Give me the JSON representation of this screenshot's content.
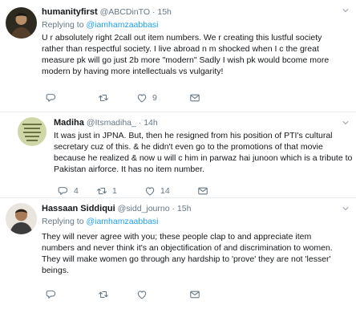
{
  "tweets": [
    {
      "name": "humanityfirst",
      "handle": "@ABCDinTO",
      "dot": "·",
      "time": "15h",
      "replying_label": "Replying to",
      "replying_to": "@iamhamzaabbasi",
      "lines": [
        "U r absolutely right 2call out item numbers. We r creating this lustful society",
        "rather than respectful society. I live abroad n m shocked when I c the great",
        "measure pk will go just 2b more \"modern\" Sadly I wish pk would bcome more",
        "modern by having more intellectuals vs vulgarity!"
      ],
      "replies": "",
      "retweets": "",
      "likes": "9"
    },
    {
      "name": "Madiha",
      "handle": "@Itsmadiha_",
      "dot": "·",
      "time": "14h",
      "lines": [
        "It was just in JPNA. But, then he resigned from his position of PTI's cultural",
        "secretary cuz of this. & he didn't even go to the promotions of that movie",
        "because he realized & now u will c him in parwaz hai junoon which is a tribute to",
        "Pakistan airforce. It has no item number."
      ],
      "replies": "4",
      "retweets": "1",
      "likes": "14"
    },
    {
      "name": "Hassaan Siddiqui",
      "handle": "@sidd_journo",
      "dot": "·",
      "time": "15h",
      "replying_label": "Replying to",
      "replying_to": "@iamhamzaabbasi",
      "lines": [
        "They will never agree with you; these people clap to and appreciate item",
        "numbers and never think it's an objectification of and discrimination to women.",
        "They will make women go through any hardship to 'prove' they are not 'lesser'",
        "beings."
      ],
      "replies": "",
      "retweets": "",
      "likes": ""
    }
  ],
  "colors": {
    "accent": "#1da1f2",
    "secondary_text": "#657786",
    "primary_text": "#14171a",
    "divider": "#e6ecf0"
  },
  "icons": [
    "reply-icon",
    "retweet-icon",
    "like-icon",
    "mail-icon",
    "caret-down-icon"
  ]
}
